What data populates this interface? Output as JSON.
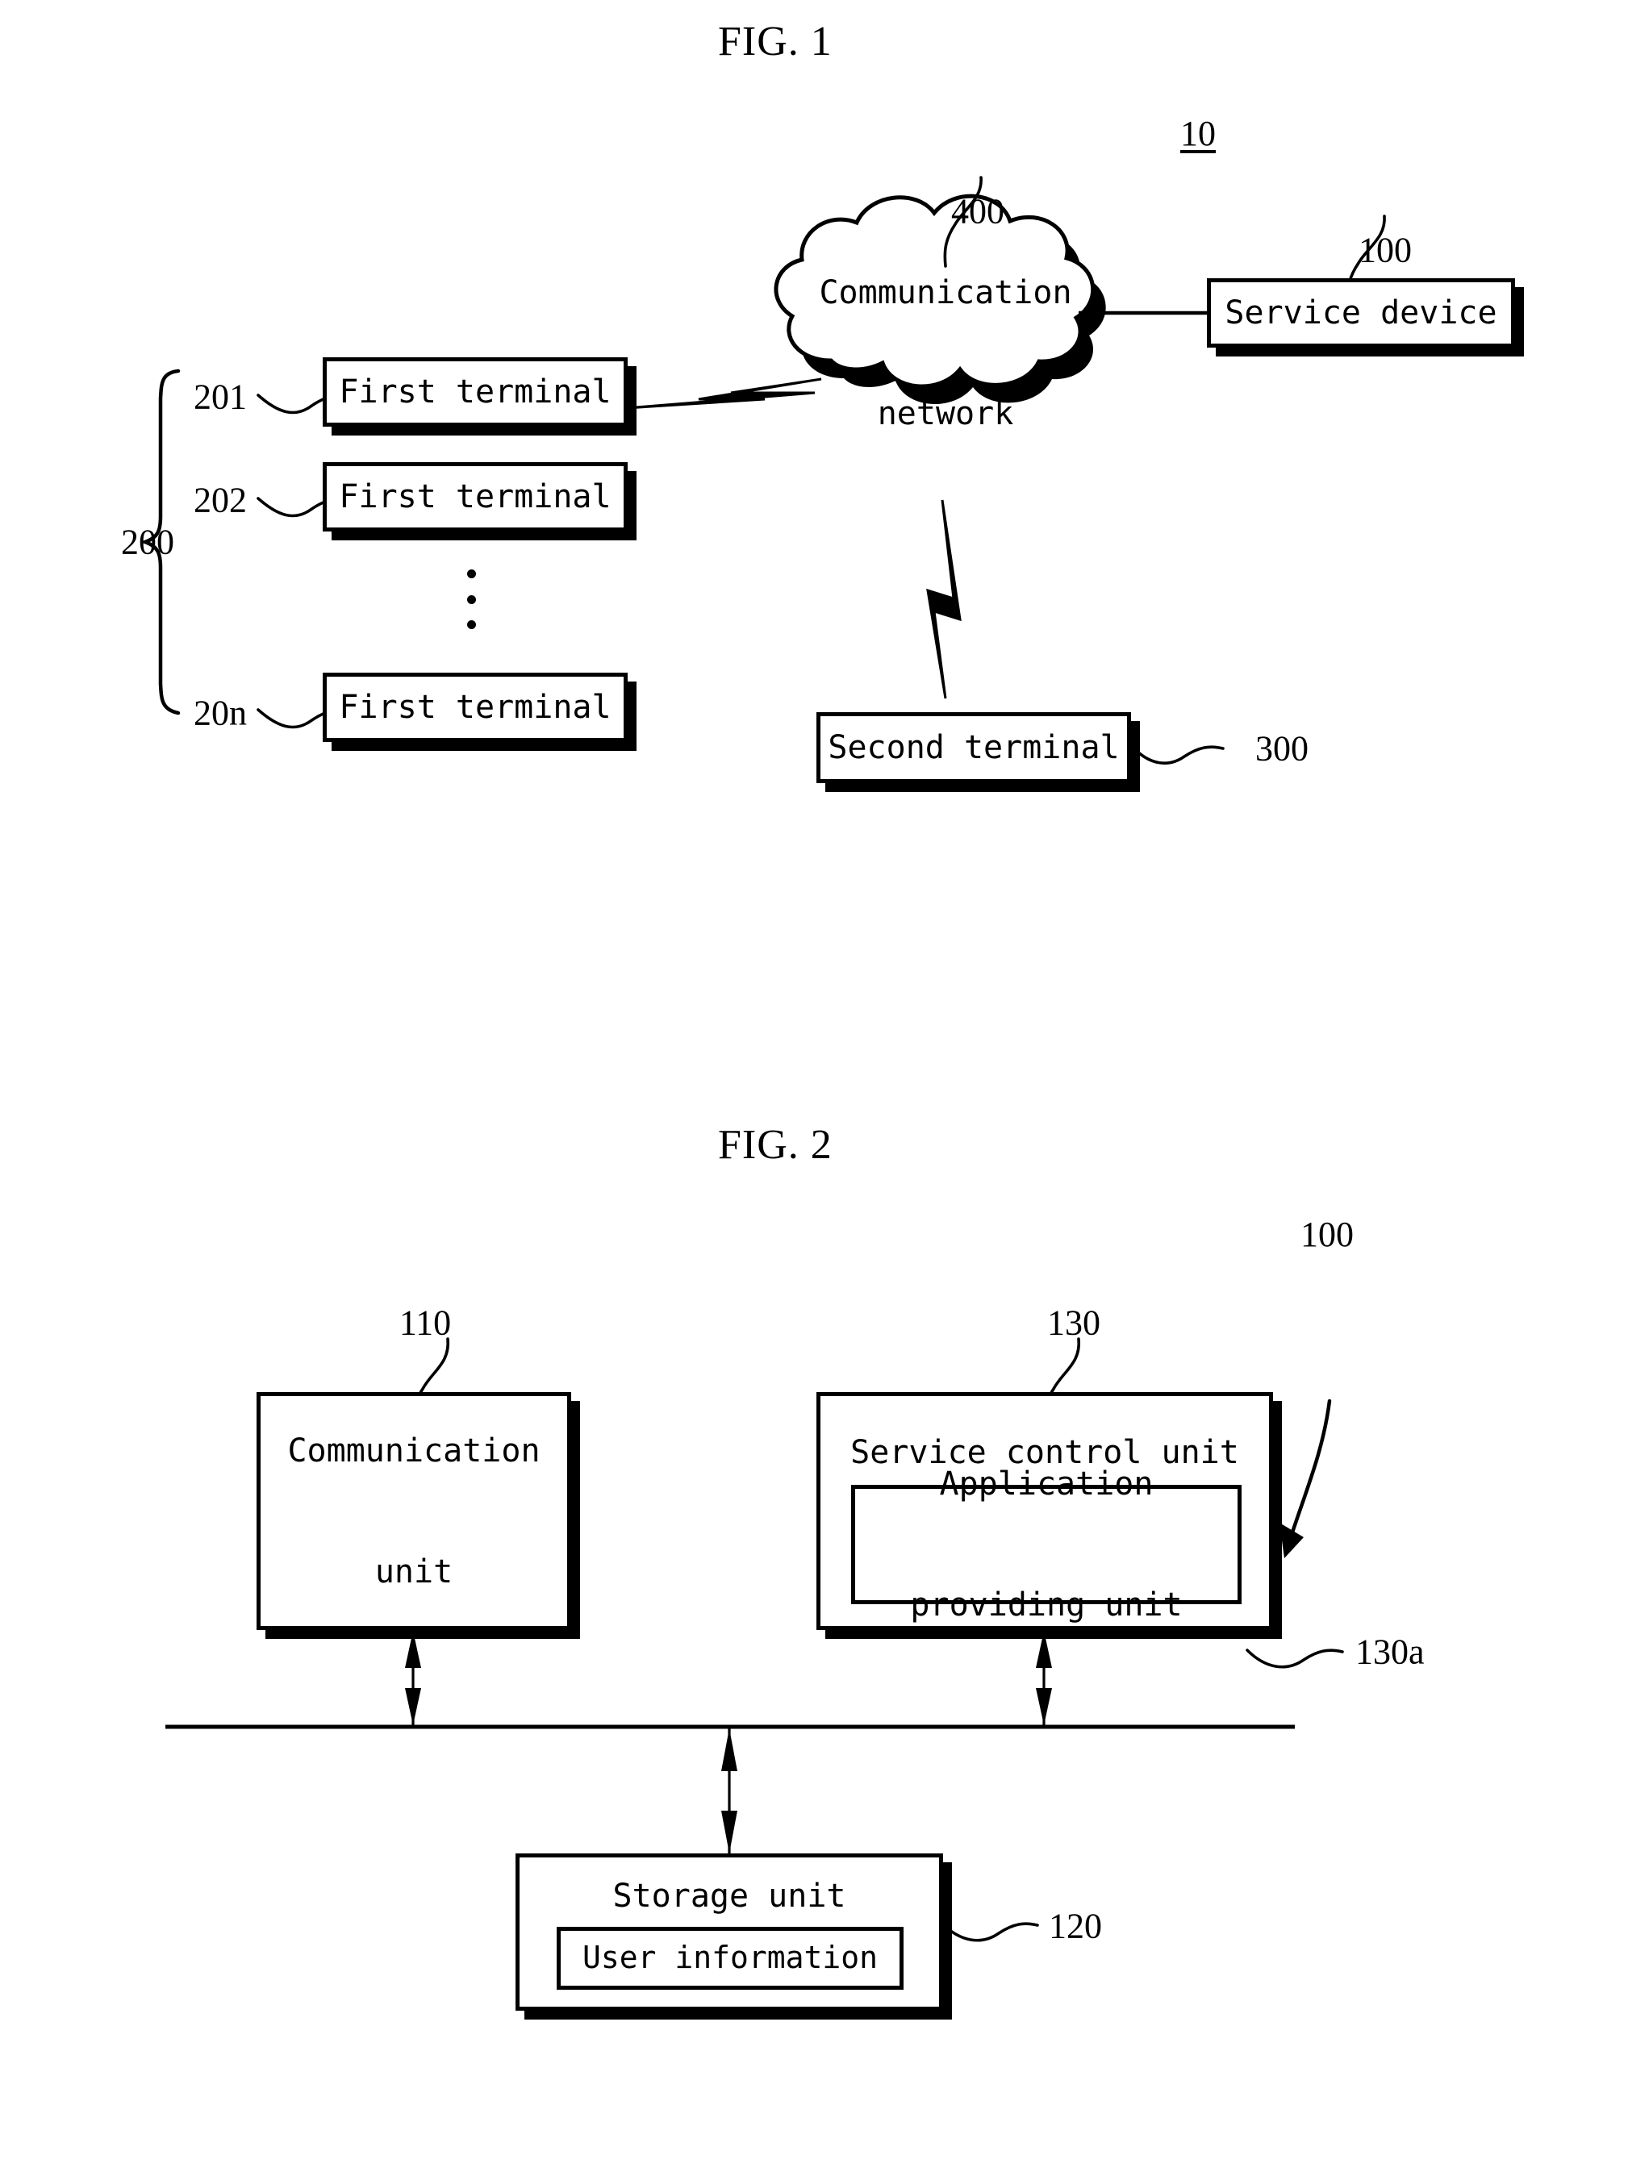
{
  "figures": [
    {
      "id": "fig1",
      "title": "FIG. 1",
      "system_ref": "10",
      "nodes": {
        "terminal_group_ref": "200",
        "terminals": [
          {
            "ref": "201",
            "label": "First terminal"
          },
          {
            "ref": "202",
            "label": "First terminal"
          },
          {
            "ref": "20n",
            "label": "First terminal"
          }
        ],
        "ellipsis": "⋮",
        "network": {
          "ref": "400",
          "label_line1": "Communication",
          "label_line2": "network"
        },
        "service_device": {
          "ref": "100",
          "label": "Service device"
        },
        "second_terminal": {
          "ref": "300",
          "label": "Second terminal"
        }
      }
    },
    {
      "id": "fig2",
      "title": "FIG. 2",
      "device_ref": "100",
      "nodes": {
        "communication_unit": {
          "ref": "110",
          "label_line1": "Communication",
          "label_line2": "unit"
        },
        "service_control_unit": {
          "ref": "130",
          "label": "Service control unit",
          "sub": {
            "ref": "130a",
            "label_line1": "Application",
            "label_line2": "providing unit"
          }
        },
        "storage_unit": {
          "ref": "120",
          "label": "Storage unit",
          "sub": {
            "label": "User information"
          }
        }
      }
    }
  ],
  "colors": {
    "ink": "#000000",
    "paper": "#ffffff"
  }
}
